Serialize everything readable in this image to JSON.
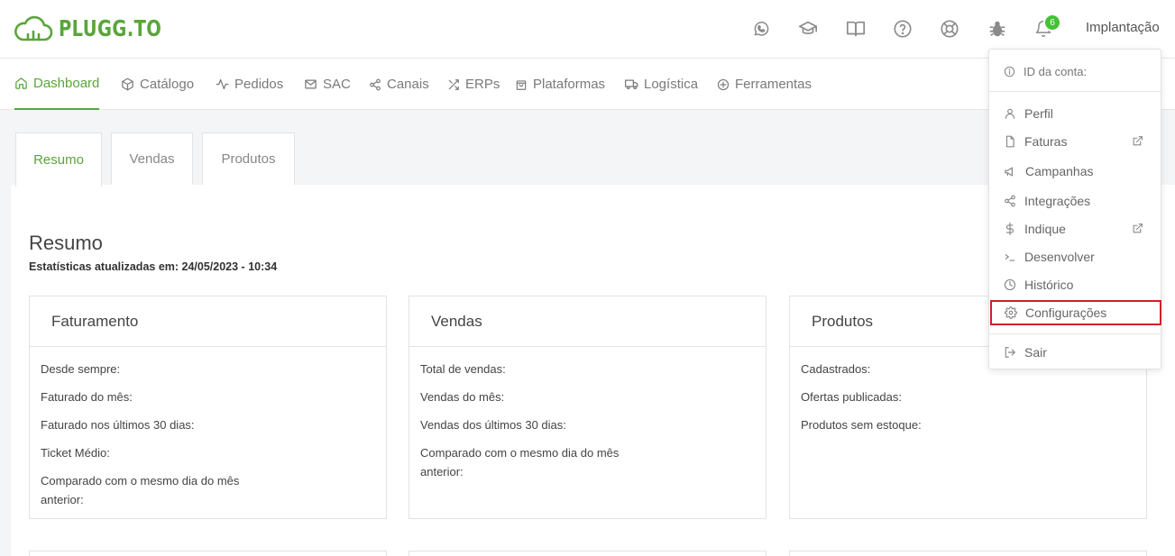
{
  "header": {
    "logo_text": "PLUGG.TO",
    "notifications_count": "6",
    "user_name": "Implantação",
    "icons": [
      "whatsapp-icon",
      "graduation-cap-icon",
      "book-icon",
      "help-icon",
      "support-lifebuoy-icon",
      "bug-icon",
      "bell-icon"
    ]
  },
  "nav": {
    "items": [
      {
        "label": "Dashboard",
        "icon": "home-icon"
      },
      {
        "label": "Catálogo",
        "icon": "box-icon"
      },
      {
        "label": "Pedidos",
        "icon": "activity-icon"
      },
      {
        "label": "SAC",
        "icon": "mail-icon"
      },
      {
        "label": "Canais",
        "icon": "share-icon"
      },
      {
        "label": "ERPs",
        "icon": "shuffle-icon"
      },
      {
        "label": "Plataformas",
        "icon": "shopping-bag-icon"
      },
      {
        "label": "Logística",
        "icon": "truck-icon"
      },
      {
        "label": "Ferramentas",
        "icon": "plus-circle-icon"
      }
    ],
    "active": "Dashboard"
  },
  "tabs": [
    "Resumo",
    "Vendas",
    "Produtos"
  ],
  "active_tab": "Resumo",
  "page": {
    "title": "Resumo",
    "subtitle": "Estatísticas atualizadas em: 24/05/2023 - 10:34"
  },
  "cards": [
    {
      "title": "Faturamento",
      "rows": [
        "Desde sempre:",
        "Faturado do mês:",
        "Faturado nos últimos 30 dias:",
        "Ticket Médio:",
        "Comparado com o mesmo dia do mês anterior:"
      ]
    },
    {
      "title": "Vendas",
      "rows": [
        "Total de vendas:",
        "Vendas do mês:",
        "Vendas dos últimos 30 dias:",
        "Comparado com o mesmo dia do mês anterior:"
      ]
    },
    {
      "title": "Produtos",
      "rows": [
        "Cadastrados:",
        "Ofertas publicadas:",
        "Produtos sem estoque:"
      ]
    }
  ],
  "dropdown": {
    "account_label": "ID da conta:",
    "items": [
      {
        "label": "Perfil",
        "icon": "user-icon",
        "external": false
      },
      {
        "label": "Faturas",
        "icon": "file-icon",
        "external": true
      },
      {
        "label": "Campanhas",
        "icon": "megaphone-icon",
        "external": false
      },
      {
        "label": "Integrações",
        "icon": "share-icon",
        "external": false
      },
      {
        "label": "Indique",
        "icon": "dollar-icon",
        "external": true
      },
      {
        "label": "Desenvolver",
        "icon": "terminal-icon",
        "external": false
      },
      {
        "label": "Histórico",
        "icon": "clock-icon",
        "external": false
      },
      {
        "label": "Configurações",
        "icon": "gear-icon",
        "external": false
      }
    ],
    "logout_label": "Sair",
    "highlighted": "Configurações"
  },
  "colors": {
    "brand_green": "#5aa53c",
    "badge_green": "#44c235",
    "highlight_red": "#d0202a"
  }
}
